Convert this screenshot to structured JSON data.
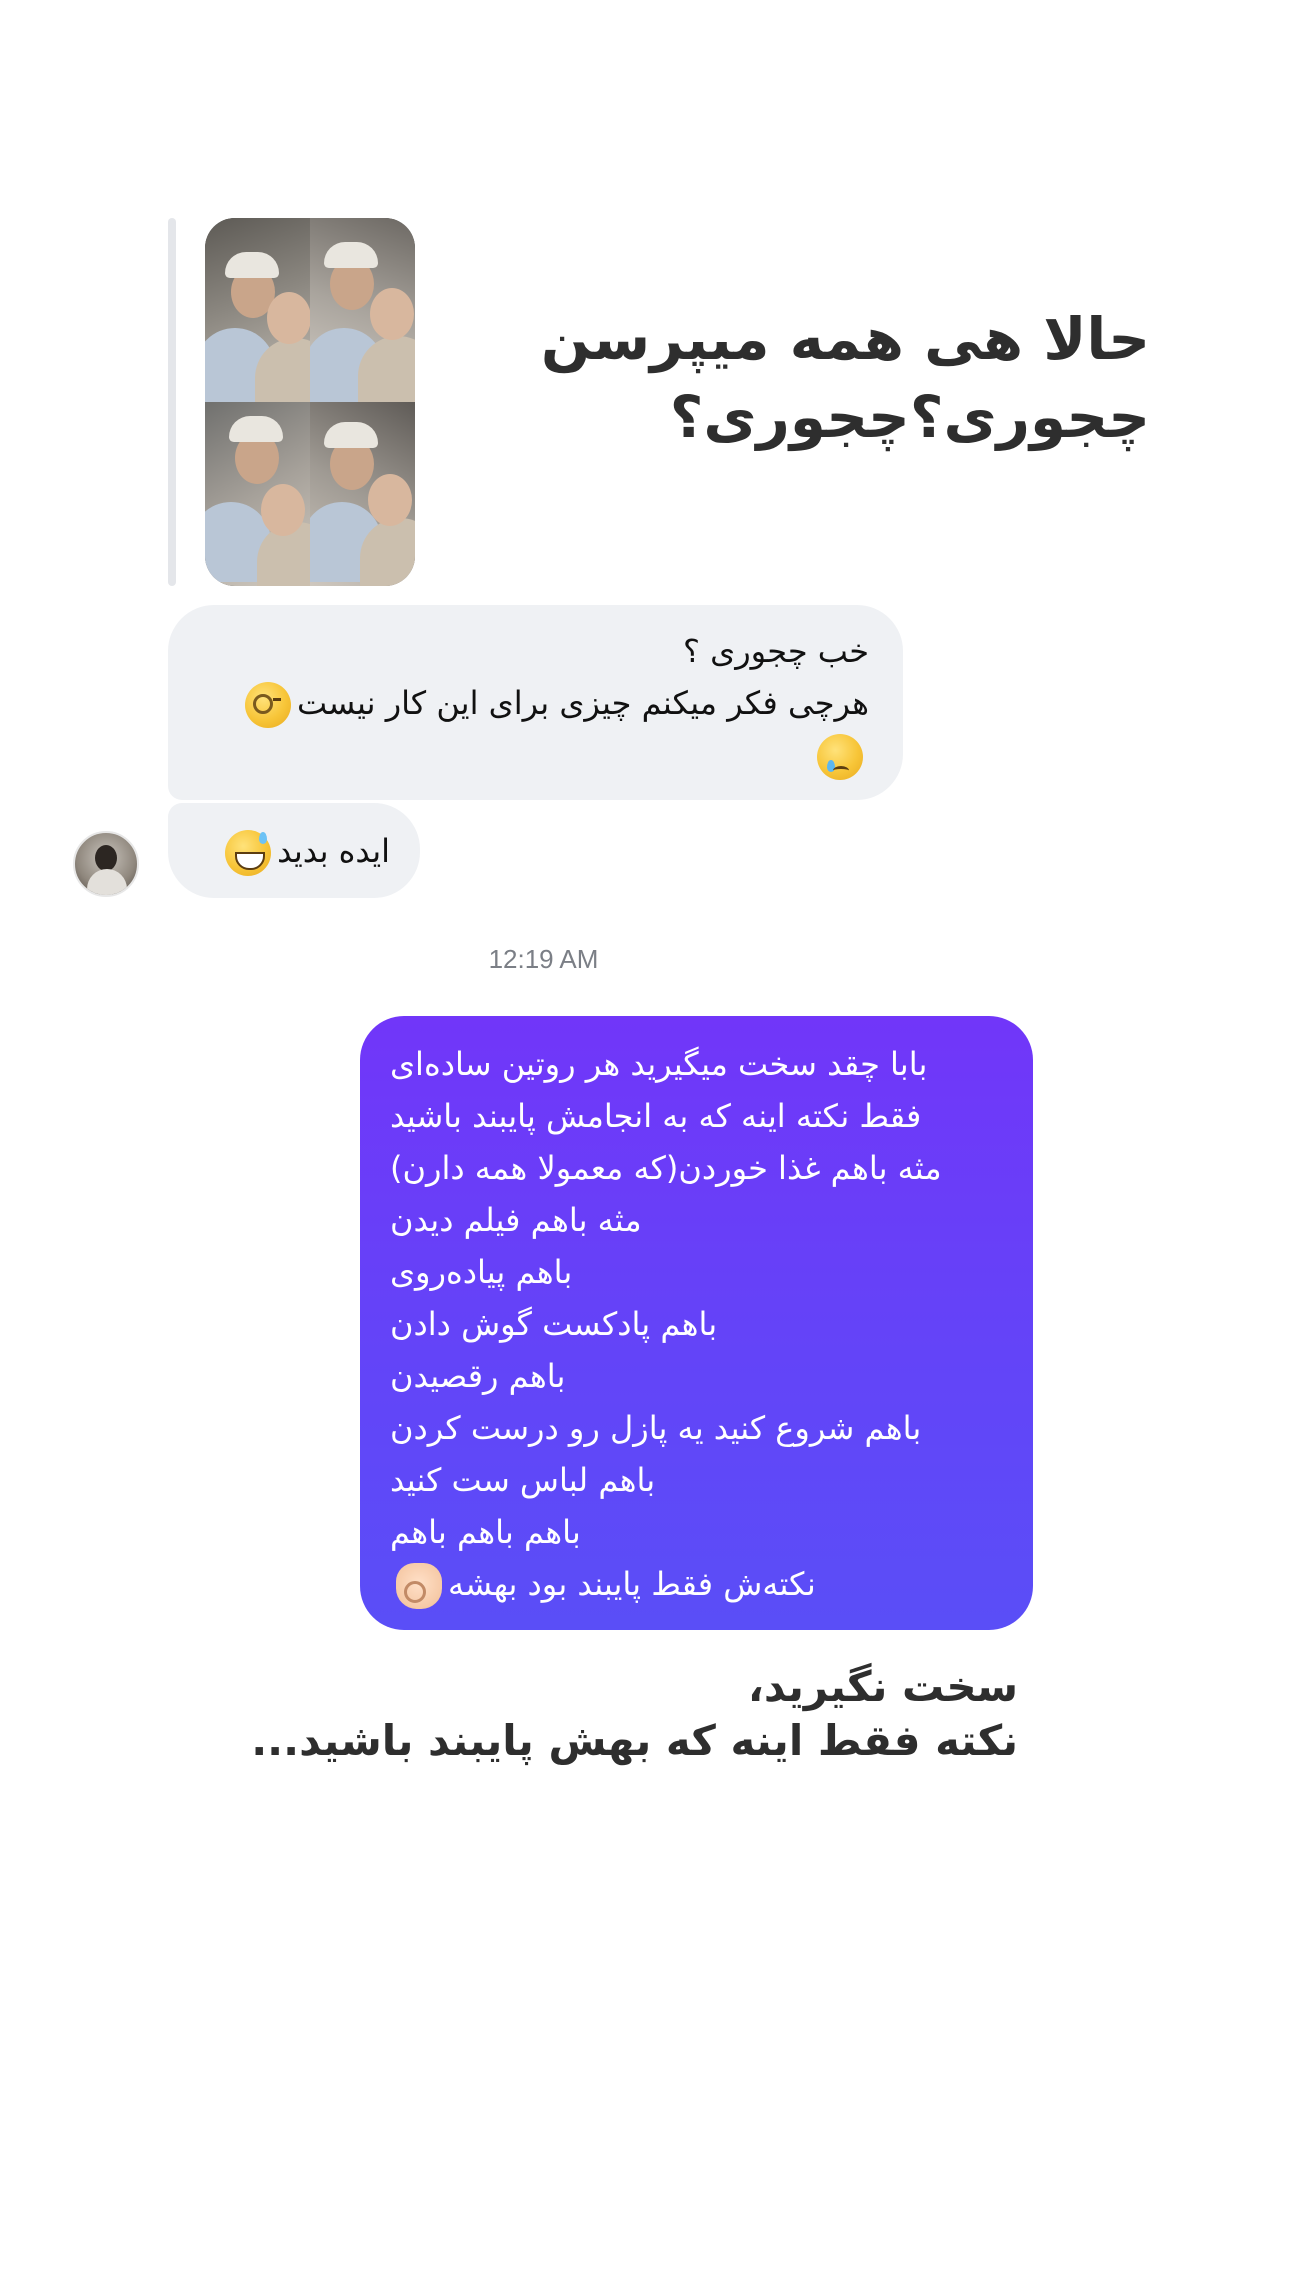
{
  "story": {
    "thumbnail_caption_lines": [
      "..."
    ],
    "heading": "حالا هی همه میپرسن\nچجوری؟چجوری؟"
  },
  "incoming": {
    "message1_lines": [
      "خب چجوری ؟",
      "هرچی فکر میکنم چیزی برای این کار نیست"
    ],
    "message1_emojis": [
      "face-with-monocle-emoji",
      "crying-face-emoji"
    ],
    "message2_text": "ایده بدید",
    "message2_emoji": "grinning-face-with-sweat-emoji"
  },
  "timestamp": "12:19 AM",
  "outgoing": {
    "lines": [
      "بابا چقد سخت میگیرید هر روتین ساده‌ای",
      "فقط نکته اینه که به انجامش پایبند باشید",
      "مثه باهم غذا خوردن(که معمولا همه دارن)",
      "مثه باهم فیلم دیدن",
      "باهم پیاده‌روی",
      "باهم پادکست گوش دادن",
      "باهم رقصیدن",
      "باهم شروع کنید یه پازل رو درست کردن",
      "باهم لباس ست کنید",
      "باهم باهم باهم",
      "نکته‌ش فقط پایبند بود بهشه"
    ],
    "last_line_emoji": "ok-hand-emoji",
    "bubble_colors": [
      "#7136f9",
      "#5a4ef7"
    ]
  },
  "bottom_caption": {
    "line1": "سخت نگیرید،",
    "line2": "نکته فقط اینه که بهش پایبند باشید..."
  }
}
